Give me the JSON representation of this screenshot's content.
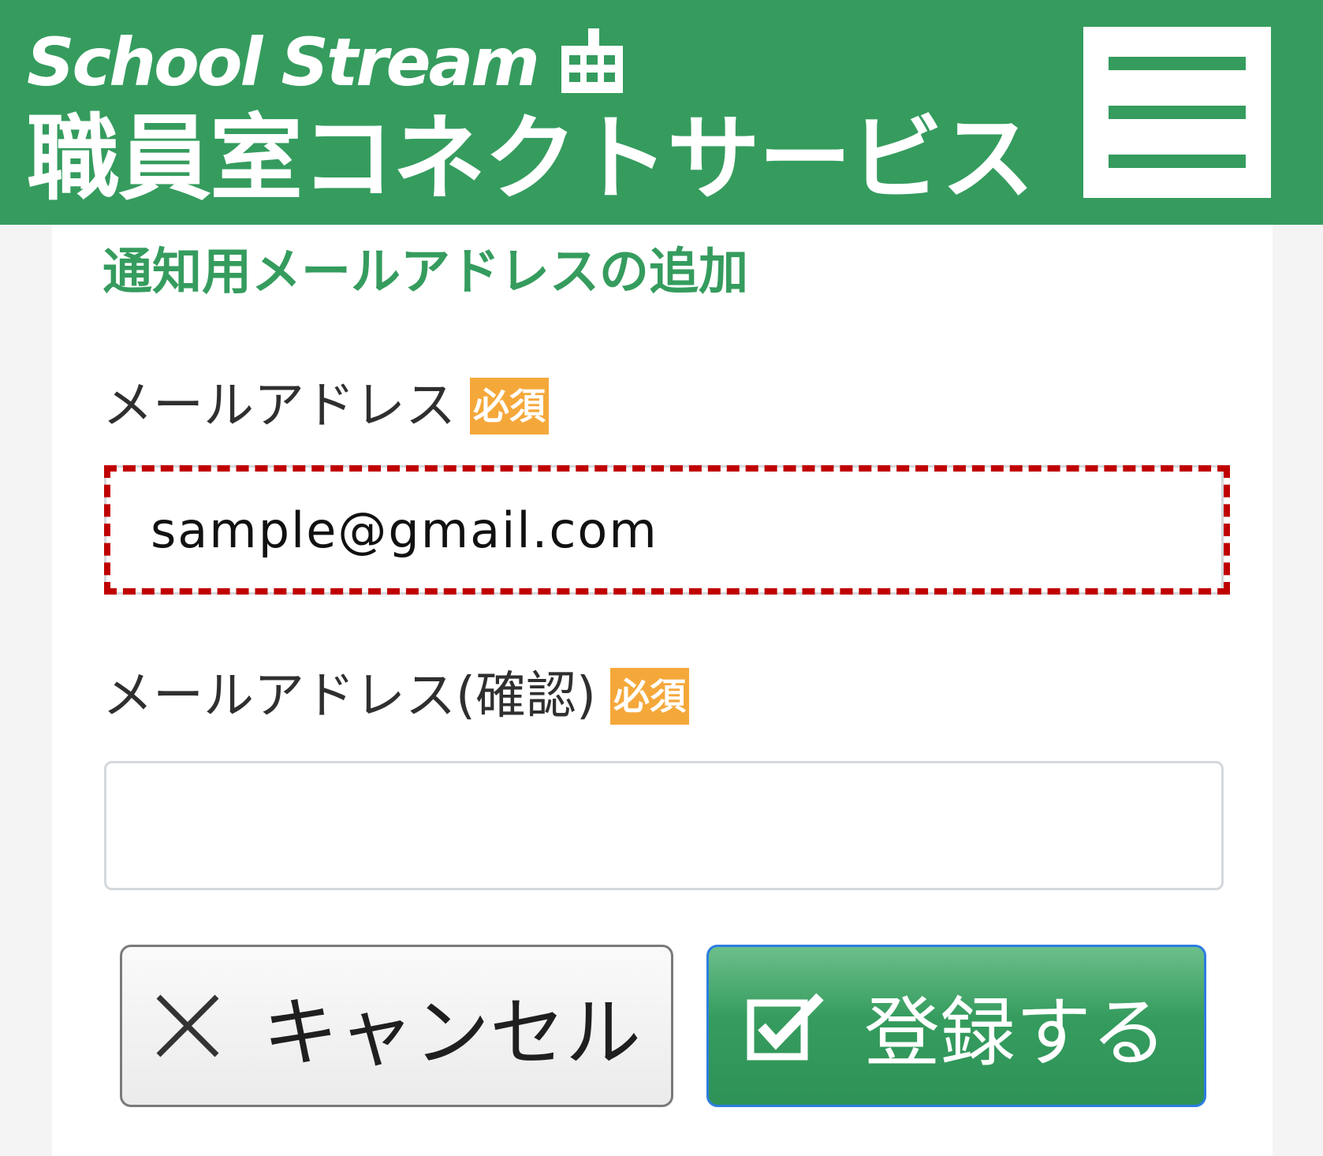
{
  "header": {
    "brand": "School Stream",
    "service_name": "職員室コネクトサービス",
    "menu_icon": "hamburger-menu-icon"
  },
  "page": {
    "title": "通知用メールアドレスの追加"
  },
  "form": {
    "email": {
      "label": "メールアドレス",
      "required": "必須",
      "value": "sample@gmail.com"
    },
    "email_confirm": {
      "label": "メールアドレス(確認)",
      "required": "必須",
      "value": ""
    }
  },
  "buttons": {
    "cancel": {
      "label": "キャンセル",
      "icon": "close-icon"
    },
    "submit": {
      "label": "登録する",
      "icon": "checkbox-checked-icon"
    }
  },
  "colors": {
    "brand_green": "#359c5e",
    "required_badge": "#f5a83a",
    "highlight_red": "#c00000",
    "submit_border": "#2d7de0"
  }
}
